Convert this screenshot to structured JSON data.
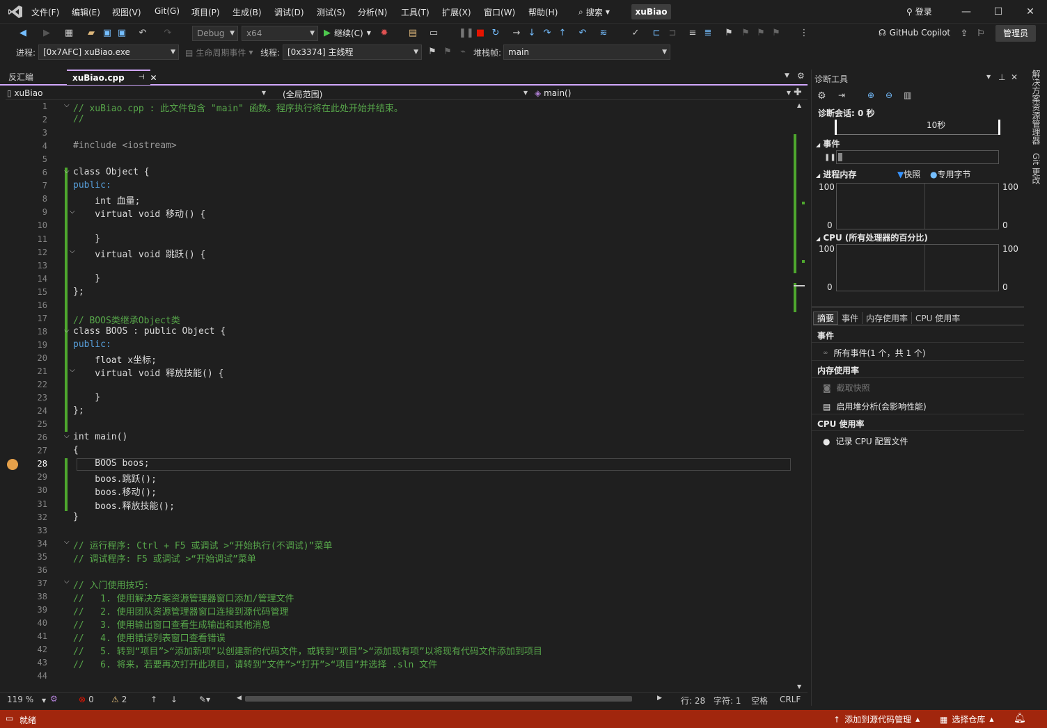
{
  "menu": [
    "文件(F)",
    "编辑(E)",
    "视图(V)",
    "Git(G)",
    "项目(P)",
    "生成(B)",
    "调试(D)",
    "测试(S)",
    "分析(N)",
    "工具(T)",
    "扩展(X)",
    "窗口(W)",
    "帮助(H)"
  ],
  "search_label": "搜索",
  "project_name": "xuBiao",
  "login_label": "登录",
  "toolbar": {
    "config": "Debug",
    "platform": "x64",
    "continue_label": "继续(C)",
    "copilot_label": "GitHub Copilot",
    "admin_label": "管理员"
  },
  "debugbar": {
    "process_label": "进程:",
    "process_value": "[0x7AFC] xuBiao.exe",
    "lifecycle_label": "生命周期事件",
    "thread_label": "线程:",
    "thread_value": "[0x3374] 主线程",
    "stackframe_label": "堆栈帧:",
    "stackframe_value": "main"
  },
  "tabs": {
    "disasm": "反汇编",
    "active": "xuBiao.cpp"
  },
  "nav": {
    "project": "xuBiao",
    "scope": "(全局范围)",
    "member": "main()"
  },
  "code_lines": [
    {
      "n": "1",
      "t": "// xuBiao.cpp : 此文件包含 \"main\" 函数。程序执行将在此处开始并结束。",
      "c": "cm"
    },
    {
      "n": "2",
      "t": "//",
      "c": "cm"
    },
    {
      "n": "3",
      "t": "",
      "c": ""
    },
    {
      "n": "4",
      "t": "#include <iostream>",
      "c": "pp"
    },
    {
      "n": "5",
      "t": "",
      "c": ""
    },
    {
      "n": "6",
      "t": "class Object {",
      "c": ""
    },
    {
      "n": "7",
      "t": "public:",
      "c": "kw"
    },
    {
      "n": "8",
      "t": "    int 血量;",
      "c": ""
    },
    {
      "n": "9",
      "t": "    virtual void 移动() {",
      "c": ""
    },
    {
      "n": "10",
      "t": "",
      "c": ""
    },
    {
      "n": "11",
      "t": "    }",
      "c": ""
    },
    {
      "n": "12",
      "t": "    virtual void 跳跃() {",
      "c": ""
    },
    {
      "n": "13",
      "t": "",
      "c": ""
    },
    {
      "n": "14",
      "t": "    }",
      "c": ""
    },
    {
      "n": "15",
      "t": "};",
      "c": ""
    },
    {
      "n": "16",
      "t": "",
      "c": ""
    },
    {
      "n": "17",
      "t": "// BOOS类继承Object类",
      "c": "cm"
    },
    {
      "n": "18",
      "t": "class BOOS : public Object {",
      "c": ""
    },
    {
      "n": "19",
      "t": "public:",
      "c": "kw"
    },
    {
      "n": "20",
      "t": "    float x坐标;",
      "c": ""
    },
    {
      "n": "21",
      "t": "    virtual void 释放技能() {",
      "c": ""
    },
    {
      "n": "22",
      "t": "",
      "c": ""
    },
    {
      "n": "23",
      "t": "    }",
      "c": ""
    },
    {
      "n": "24",
      "t": "};",
      "c": ""
    },
    {
      "n": "25",
      "t": "",
      "c": ""
    },
    {
      "n": "26",
      "t": "int main()",
      "c": ""
    },
    {
      "n": "27",
      "t": "{",
      "c": ""
    },
    {
      "n": "28",
      "t": "    BOOS boos;",
      "c": ""
    },
    {
      "n": "29",
      "t": "    boos.跳跃();",
      "c": ""
    },
    {
      "n": "30",
      "t": "    boos.移动();",
      "c": ""
    },
    {
      "n": "31",
      "t": "    boos.释放技能();",
      "c": ""
    },
    {
      "n": "32",
      "t": "}",
      "c": ""
    },
    {
      "n": "33",
      "t": "",
      "c": ""
    },
    {
      "n": "34",
      "t": "// 运行程序: Ctrl + F5 或调试 >“开始执行(不调试)”菜单",
      "c": "cm"
    },
    {
      "n": "35",
      "t": "// 调试程序: F5 或调试 >“开始调试”菜单",
      "c": "cm"
    },
    {
      "n": "36",
      "t": "",
      "c": ""
    },
    {
      "n": "37",
      "t": "// 入门使用技巧:",
      "c": "cm"
    },
    {
      "n": "38",
      "t": "//   1. 使用解决方案资源管理器窗口添加/管理文件",
      "c": "cm"
    },
    {
      "n": "39",
      "t": "//   2. 使用团队资源管理器窗口连接到源代码管理",
      "c": "cm"
    },
    {
      "n": "40",
      "t": "//   3. 使用输出窗口查看生成输出和其他消息",
      "c": "cm"
    },
    {
      "n": "41",
      "t": "//   4. 使用错误列表窗口查看错误",
      "c": "cm"
    },
    {
      "n": "42",
      "t": "//   5. 转到“项目”>“添加新项”以创建新的代码文件，或转到“项目”>“添加现有项”以将现有代码文件添加到项目",
      "c": "cm"
    },
    {
      "n": "43",
      "t": "//   6. 将来，若要再次打开此项目，请转到“文件”>“打开”>“项目”并选择 .sln 文件",
      "c": "cm"
    },
    {
      "n": "44",
      "t": "",
      "c": ""
    }
  ],
  "editor_status": {
    "zoom": "119 %",
    "errors": "0",
    "warnings": "2",
    "line": "行: 28",
    "col": "字符: 1",
    "indent": "空格",
    "eol": "CRLF"
  },
  "diagnostics": {
    "title": "诊断工具",
    "session": "诊断会话: 0 秒",
    "timeline_label": "10秒",
    "events_header": "事件",
    "memory_header": "进程内存",
    "snapshot_legend": "快照",
    "private_bytes_legend": "专用字节",
    "cpu_header": "CPU (所有处理器的百分比)",
    "axis_max": "100",
    "axis_min": "0",
    "tabs": [
      "摘要",
      "事件",
      "内存使用率",
      "CPU 使用率"
    ],
    "sec_events": "事件",
    "all_events": "所有事件(1 个，共 1 个)",
    "sec_memory": "内存使用率",
    "take_snapshot": "截取快照",
    "heap_analysis": "启用堆分析(会影响性能)",
    "sec_cpu": "CPU 使用率",
    "record_cpu": "记录 CPU 配置文件"
  },
  "rightrail": {
    "solution_explorer": "解决方案资源管理器",
    "git_changes": "Git 更改"
  },
  "statusbar": {
    "ready": "就绪",
    "add_source": "添加到源代码管理",
    "select_repo": "选择仓库"
  },
  "colors": {
    "statusbar_bg": "#a1260d",
    "change_bar": "#4ea72e",
    "comment": "#57a64a",
    "keyword": "#569cd6",
    "type": "#4ec9b0"
  }
}
